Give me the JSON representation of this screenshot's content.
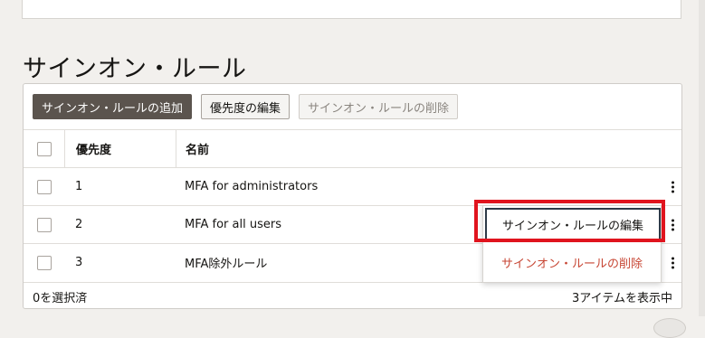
{
  "page": {
    "title": "サインオン・ルール"
  },
  "toolbar": {
    "add_label": "サインオン・ルールの追加",
    "edit_priority_label": "優先度の編集",
    "delete_label": "サインオン・ルールの削除"
  },
  "table": {
    "headers": {
      "priority": "優先度",
      "name": "名前"
    },
    "rows": [
      {
        "priority": "1",
        "name": "MFA for administrators"
      },
      {
        "priority": "2",
        "name": "MFA for all users"
      },
      {
        "priority": "3",
        "name": "MFA除外ルール"
      }
    ]
  },
  "footer": {
    "selected": "0を選択済",
    "count": "3アイテムを表示中"
  },
  "context_menu": {
    "edit_label": "サインオン・ルールの編集",
    "delete_label": "サインオン・ルールの削除"
  },
  "colors": {
    "primary_button": "#5b544e",
    "danger_text": "#c74634",
    "highlight": "#e0141e"
  }
}
